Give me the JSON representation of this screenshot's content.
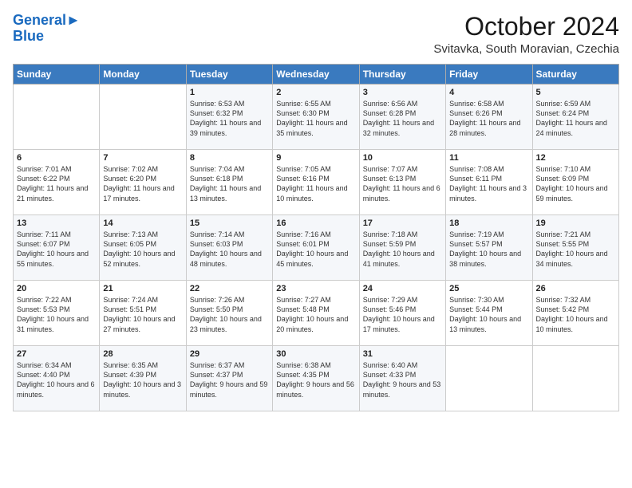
{
  "header": {
    "logo_line1": "General",
    "logo_line2": "Blue",
    "month_title": "October 2024",
    "location": "Svitavka, South Moravian, Czechia"
  },
  "days_of_week": [
    "Sunday",
    "Monday",
    "Tuesday",
    "Wednesday",
    "Thursday",
    "Friday",
    "Saturday"
  ],
  "weeks": [
    [
      {
        "day": "",
        "info": ""
      },
      {
        "day": "",
        "info": ""
      },
      {
        "day": "1",
        "info": "Sunrise: 6:53 AM\nSunset: 6:32 PM\nDaylight: 11 hours and 39 minutes."
      },
      {
        "day": "2",
        "info": "Sunrise: 6:55 AM\nSunset: 6:30 PM\nDaylight: 11 hours and 35 minutes."
      },
      {
        "day": "3",
        "info": "Sunrise: 6:56 AM\nSunset: 6:28 PM\nDaylight: 11 hours and 32 minutes."
      },
      {
        "day": "4",
        "info": "Sunrise: 6:58 AM\nSunset: 6:26 PM\nDaylight: 11 hours and 28 minutes."
      },
      {
        "day": "5",
        "info": "Sunrise: 6:59 AM\nSunset: 6:24 PM\nDaylight: 11 hours and 24 minutes."
      }
    ],
    [
      {
        "day": "6",
        "info": "Sunrise: 7:01 AM\nSunset: 6:22 PM\nDaylight: 11 hours and 21 minutes."
      },
      {
        "day": "7",
        "info": "Sunrise: 7:02 AM\nSunset: 6:20 PM\nDaylight: 11 hours and 17 minutes."
      },
      {
        "day": "8",
        "info": "Sunrise: 7:04 AM\nSunset: 6:18 PM\nDaylight: 11 hours and 13 minutes."
      },
      {
        "day": "9",
        "info": "Sunrise: 7:05 AM\nSunset: 6:16 PM\nDaylight: 11 hours and 10 minutes."
      },
      {
        "day": "10",
        "info": "Sunrise: 7:07 AM\nSunset: 6:13 PM\nDaylight: 11 hours and 6 minutes."
      },
      {
        "day": "11",
        "info": "Sunrise: 7:08 AM\nSunset: 6:11 PM\nDaylight: 11 hours and 3 minutes."
      },
      {
        "day": "12",
        "info": "Sunrise: 7:10 AM\nSunset: 6:09 PM\nDaylight: 10 hours and 59 minutes."
      }
    ],
    [
      {
        "day": "13",
        "info": "Sunrise: 7:11 AM\nSunset: 6:07 PM\nDaylight: 10 hours and 55 minutes."
      },
      {
        "day": "14",
        "info": "Sunrise: 7:13 AM\nSunset: 6:05 PM\nDaylight: 10 hours and 52 minutes."
      },
      {
        "day": "15",
        "info": "Sunrise: 7:14 AM\nSunset: 6:03 PM\nDaylight: 10 hours and 48 minutes."
      },
      {
        "day": "16",
        "info": "Sunrise: 7:16 AM\nSunset: 6:01 PM\nDaylight: 10 hours and 45 minutes."
      },
      {
        "day": "17",
        "info": "Sunrise: 7:18 AM\nSunset: 5:59 PM\nDaylight: 10 hours and 41 minutes."
      },
      {
        "day": "18",
        "info": "Sunrise: 7:19 AM\nSunset: 5:57 PM\nDaylight: 10 hours and 38 minutes."
      },
      {
        "day": "19",
        "info": "Sunrise: 7:21 AM\nSunset: 5:55 PM\nDaylight: 10 hours and 34 minutes."
      }
    ],
    [
      {
        "day": "20",
        "info": "Sunrise: 7:22 AM\nSunset: 5:53 PM\nDaylight: 10 hours and 31 minutes."
      },
      {
        "day": "21",
        "info": "Sunrise: 7:24 AM\nSunset: 5:51 PM\nDaylight: 10 hours and 27 minutes."
      },
      {
        "day": "22",
        "info": "Sunrise: 7:26 AM\nSunset: 5:50 PM\nDaylight: 10 hours and 23 minutes."
      },
      {
        "day": "23",
        "info": "Sunrise: 7:27 AM\nSunset: 5:48 PM\nDaylight: 10 hours and 20 minutes."
      },
      {
        "day": "24",
        "info": "Sunrise: 7:29 AM\nSunset: 5:46 PM\nDaylight: 10 hours and 17 minutes."
      },
      {
        "day": "25",
        "info": "Sunrise: 7:30 AM\nSunset: 5:44 PM\nDaylight: 10 hours and 13 minutes."
      },
      {
        "day": "26",
        "info": "Sunrise: 7:32 AM\nSunset: 5:42 PM\nDaylight: 10 hours and 10 minutes."
      }
    ],
    [
      {
        "day": "27",
        "info": "Sunrise: 6:34 AM\nSunset: 4:40 PM\nDaylight: 10 hours and 6 minutes."
      },
      {
        "day": "28",
        "info": "Sunrise: 6:35 AM\nSunset: 4:39 PM\nDaylight: 10 hours and 3 minutes."
      },
      {
        "day": "29",
        "info": "Sunrise: 6:37 AM\nSunset: 4:37 PM\nDaylight: 9 hours and 59 minutes."
      },
      {
        "day": "30",
        "info": "Sunrise: 6:38 AM\nSunset: 4:35 PM\nDaylight: 9 hours and 56 minutes."
      },
      {
        "day": "31",
        "info": "Sunrise: 6:40 AM\nSunset: 4:33 PM\nDaylight: 9 hours and 53 minutes."
      },
      {
        "day": "",
        "info": ""
      },
      {
        "day": "",
        "info": ""
      }
    ]
  ]
}
